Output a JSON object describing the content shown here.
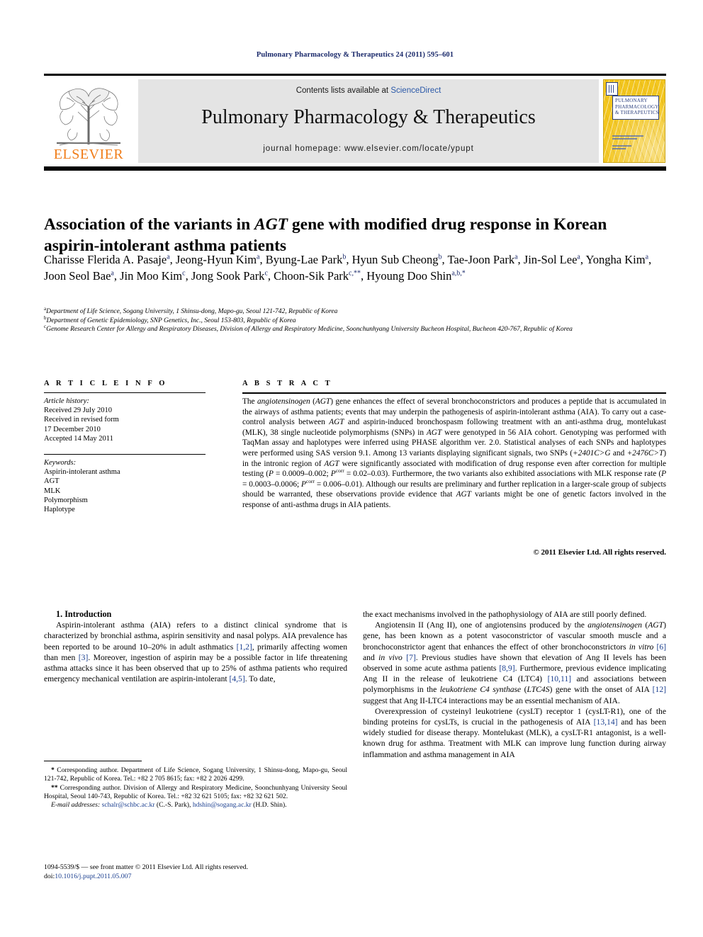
{
  "running_head": "Pulmonary Pharmacology & Therapeutics 24 (2011) 595–601",
  "masthead": {
    "contents_prefix": "Contents lists available at ",
    "sciencedirect": "ScienceDirect",
    "journal_title": "Pulmonary Pharmacology & Therapeutics",
    "homepage": "journal homepage: www.elsevier.com/locate/ypupt",
    "publisher_name": "ELSEVIER",
    "cover_title_line1": "PULMONARY",
    "cover_title_line2": "PHARMACOLOGY",
    "cover_title_line3": "& THERAPEUTICS"
  },
  "article": {
    "title_part1": "Association of the variants in ",
    "title_gene": "AGT",
    "title_part2": " gene with modified drug response in Korean aspirin-intolerant asthma patients",
    "authors": [
      {
        "name": "Charisse Flerida A. Pasaje",
        "marks": "a",
        "sep": ", "
      },
      {
        "name": "Jeong-Hyun Kim",
        "marks": "a",
        "sep": ", "
      },
      {
        "name": "Byung-Lae Park",
        "marks": "b",
        "sep": ", "
      },
      {
        "name": "Hyun Sub Cheong",
        "marks": "b",
        "sep": ", "
      },
      {
        "name": "Tae-Joon Park",
        "marks": "a",
        "sep": ", "
      },
      {
        "name": "Jin-Sol Lee",
        "marks": "a",
        "sep": ", "
      },
      {
        "name": "Yongha Kim",
        "marks": "a",
        "sep": ", "
      },
      {
        "name": "Joon Seol Bae",
        "marks": "a",
        "sep": ", "
      },
      {
        "name": "Jin Moo Kim",
        "marks": "c",
        "sep": ", "
      },
      {
        "name": "Jong Sook Park",
        "marks": "c",
        "sep": ", "
      },
      {
        "name": "Choon-Sik Park",
        "marks": "c,**",
        "sep": ", "
      },
      {
        "name": "Hyoung Doo Shin",
        "marks": "a,b,*",
        "sep": ""
      }
    ],
    "affiliations": [
      {
        "mark": "a",
        "text": "Department of Life Science, Sogang University, 1 Shinsu-dong, Mapo-gu, Seoul 121-742, Republic of Korea"
      },
      {
        "mark": "b",
        "text": "Department of Genetic Epidemiology, SNP Genetics, Inc., Seoul 153-803, Republic of Korea"
      },
      {
        "mark": "c",
        "text": "Genome Research Center for Allergy and Respiratory Diseases, Division of Allergy and Respiratory Medicine, Soonchunhyang University Bucheon Hospital, Bucheon 420-767, Republic of Korea"
      }
    ]
  },
  "article_info": {
    "heading": "A R T I C L E   I N F O",
    "history_label": "Article history:",
    "history": [
      "Received 29 July 2010",
      "Received in revised form",
      "17 December 2010",
      "Accepted 14 May 2011"
    ],
    "keywords_label": "Keywords:",
    "keywords": [
      "Aspirin-intolerant asthma",
      "AGT",
      "MLK",
      "Polymorphism",
      "Haplotype"
    ]
  },
  "abstract": {
    "heading": "A B S T R A C T",
    "body_html": "The <i>angiotensinogen</i> (<i>AGT</i>) gene enhances the effect of several bronchoconstrictors and produces a peptide that is accumulated in the airways of asthma patients; events that may underpin the pathogenesis of aspirin-intolerant asthma (AIA). To carry out a case-control analysis between <i>AGT</i> and aspirin-induced bronchospasm following treatment with an anti-asthma drug, montelukast (MLK), 38 single nucleotide polymorphisms (SNPs) in <i>AGT</i> were genotyped in 56 AIA cohort. Genotyping was performed with TaqMan assay and haplotypes were inferred using PHASE algorithm ver. 2.0. Statistical analyses of each SNPs and haplotypes were performed using SAS version 9.1. Among 13 variants displaying significant signals, two SNPs (<i>+2401C&gt;G</i> and <i>+2476C&gt;T</i>) in the intronic region of <i>AGT</i> were significantly associated with modification of drug response even after correction for multiple testing (<i>P</i> = 0.0009&ndash;0.002; <i>P</i><sup>corr</sup> = 0.02&ndash;0.03). Furthermore, the two variants also exhibited associations with MLK response rate (<i>P</i> = 0.0003&ndash;0.0006; <i>P</i><sup>corr</sup> = 0.006&ndash;0.01). Although our results are preliminary and further replication in a larger-scale group of subjects should be warranted, these observations provide evidence that <i>AGT</i> variants might be one of genetic factors involved in the response of anti-asthma drugs in AIA patients.",
    "copyright": "© 2011 Elsevier Ltd. All rights reserved."
  },
  "body": {
    "section_heading": "1. Introduction",
    "left_paragraphs_html": [
      "Aspirin-intolerant asthma (AIA) refers to a distinct clinical syndrome that is characterized by bronchial asthma, aspirin sensitivity and nasal polyps. AIA prevalence has been reported to be around 10&ndash;20% in adult asthmatics <span class=\"ref\">[1,2]</span>, primarily affecting women than men <span class=\"ref\">[3]</span>. Moreover, ingestion of aspirin may be a possible factor in life threatening asthma attacks since it has been observed that up to 25% of asthma patients who required emergency mechanical ventilation are aspirin-intolerant <span class=\"ref\">[4,5]</span>. To date,"
    ],
    "right_paragraphs_html": [
      "the exact mechanisms involved in the pathophysiology of AIA are still poorly defined.",
      "Angiotensin II (Ang II), one of angiotensins produced by the <i>angiotensinogen</i> (<i>AGT</i>) gene, has been known as a potent vasoconstrictor of vascular smooth muscle and a bronchoconstrictor agent that enhances the effect of other bronchoconstrictors <i>in vitro</i> <span class=\"ref\">[6]</span> and <i>in vivo</i> <span class=\"ref\">[7]</span>. Previous studies have shown that elevation of Ang II levels has been observed in some acute asthma patients <span class=\"ref\">[8,9]</span>. Furthermore, previous evidence implicating Ang II in the release of leukotriene C4 (LTC4) <span class=\"ref\">[10,11]</span> and associations between polymorphisms in the <i>leukotriene C4 synthase</i> (<i>LTC4S</i>) gene with the onset of AIA <span class=\"ref\">[12]</span> suggest that Ang II-LTC4 interactions may be an essential mechanism of AIA.",
      "Overexpression of cysteinyl leukotriene (cysLT) receptor 1 (cysLT-R1), one of the binding proteins for cysLTs, is crucial in the pathogenesis of AIA <span class=\"ref\">[13,14]</span> and has been widely studied for disease therapy. Montelukast (MLK), a cysLT-R1 antagonist, is a well-known drug for asthma. Treatment with MLK can improve lung function during airway inflammation and asthma management in AIA"
    ]
  },
  "footnotes": {
    "corresponding_1_html": "<b>*</b> Corresponding author. Department of Life Science, Sogang University, 1 Shinsu-dong, Mapo-gu, Seoul 121-742, Republic of Korea. Tel.: +82 2 705 8615; fax: +82 2 2026 4299.",
    "corresponding_2_html": "<b>**</b> Corresponding author. Division of Allergy and Respiratory Medicine, Soonchunhyang University Seoul Hospital, Seoul 140-743, Republic of Korea. Tel.: +82 32 621 5105; fax: +82 32 621 502.",
    "emails_label": "E-mail addresses:",
    "email_1": "schalr@schbc.ac.kr",
    "email_1_owner": "(C.-S. Park)",
    "email_2": "hdshin@sogang.ac.kr",
    "email_2_owner": "(H.D. Shin)."
  },
  "colophon": {
    "line1": "1094-5539/$ — see front matter © 2011 Elsevier Ltd. All rights reserved.",
    "doi_label": "doi:",
    "doi_value": "10.1016/j.pupt.2011.05.007"
  },
  "colors": {
    "link_blue": "#1b3f8f",
    "header_navy": "#1b2a6b",
    "elsevier_orange": "#F07D1A",
    "banner_grey": "#e4e4e4",
    "cover_yellow": "#F3C61E"
  }
}
